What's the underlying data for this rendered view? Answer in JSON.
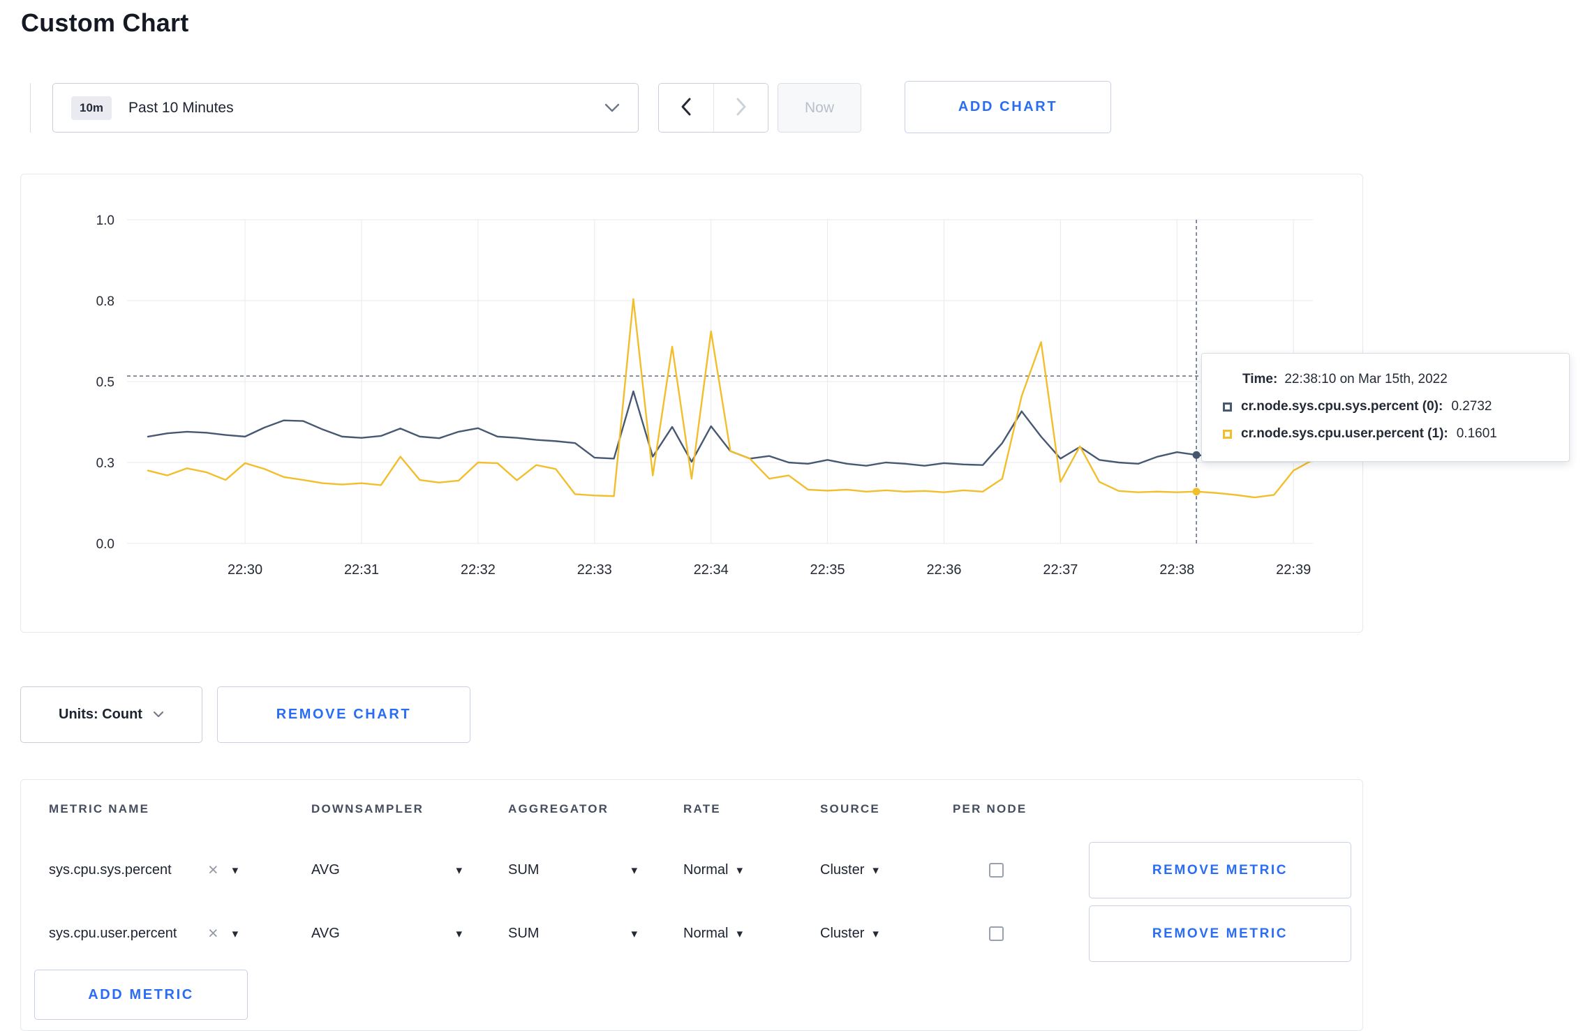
{
  "page": {
    "title": "Custom Chart"
  },
  "colors": {
    "accent_blue": "#2a6df4",
    "series_sys": "#475872",
    "series_user": "#f2be2c",
    "grid_line": "#e8eaee"
  },
  "icons": {
    "caret_down": "▾",
    "clear": "×"
  },
  "toolbar": {
    "time_badge": "10m",
    "time_range_label": "Past 10 Minutes",
    "now_label": "Now",
    "add_chart_label": "ADD CHART"
  },
  "chart_controls": {
    "units_label": "Units: Count",
    "remove_chart_label": "REMOVE CHART"
  },
  "tooltip": {
    "time_label": "Time:",
    "time_value": "22:38:10 on Mar 15th, 2022",
    "series": [
      {
        "name": "cr.node.sys.cpu.sys.percent (0):",
        "value": "0.2732"
      },
      {
        "name": "cr.node.sys.cpu.user.percent (1):",
        "value": "0.1601"
      }
    ]
  },
  "metrics_table": {
    "headers": [
      "METRIC NAME",
      "DOWNSAMPLER",
      "AGGREGATOR",
      "RATE",
      "SOURCE",
      "PER NODE"
    ],
    "rows": [
      {
        "metric": "sys.cpu.sys.percent",
        "downsampler": "AVG",
        "aggregator": "SUM",
        "rate": "Normal",
        "source": "Cluster",
        "per_node": false,
        "remove_label": "REMOVE METRIC"
      },
      {
        "metric": "sys.cpu.user.percent",
        "downsampler": "AVG",
        "aggregator": "SUM",
        "rate": "Normal",
        "source": "Cluster",
        "per_node": false,
        "remove_label": "REMOVE METRIC"
      }
    ],
    "add_metric_label": "ADD METRIC"
  },
  "chart_data": {
    "type": "line",
    "title": "",
    "x_start": "22:29:10",
    "x_end": "22:39:10",
    "x_interval_seconds": 10,
    "ylim": [
      0,
      1
    ],
    "grid": true,
    "yticks": [
      {
        "value": 0.0,
        "label": "0.0"
      },
      {
        "value": 0.25,
        "label": "0.3"
      },
      {
        "value": 0.5,
        "label": "0.5"
      },
      {
        "value": 0.75,
        "label": "0.8"
      },
      {
        "value": 1.0,
        "label": "1.0"
      }
    ],
    "xticks": [
      {
        "index": 5,
        "label": "22:30"
      },
      {
        "index": 11,
        "label": "22:31"
      },
      {
        "index": 17,
        "label": "22:32"
      },
      {
        "index": 23,
        "label": "22:33"
      },
      {
        "index": 29,
        "label": "22:34"
      },
      {
        "index": 35,
        "label": "22:35"
      },
      {
        "index": 41,
        "label": "22:36"
      },
      {
        "index": 47,
        "label": "22:37"
      },
      {
        "index": 53,
        "label": "22:38"
      },
      {
        "index": 59,
        "label": "22:39"
      }
    ],
    "crosshair": {
      "index": 54,
      "time": "22:38:10",
      "y_value": 0.517
    },
    "series": [
      {
        "name": "cr.node.sys.cpu.sys.percent",
        "color": "#475872",
        "highlight_value": 0.2732,
        "values": [
          0.33,
          0.34,
          0.345,
          0.342,
          0.335,
          0.33,
          0.358,
          0.38,
          0.378,
          0.352,
          0.33,
          0.326,
          0.332,
          0.355,
          0.33,
          0.325,
          0.345,
          0.356,
          0.33,
          0.326,
          0.32,
          0.316,
          0.31,
          0.265,
          0.262,
          0.47,
          0.268,
          0.36,
          0.252,
          0.362,
          0.285,
          0.262,
          0.27,
          0.25,
          0.246,
          0.258,
          0.246,
          0.24,
          0.25,
          0.246,
          0.24,
          0.248,
          0.244,
          0.242,
          0.31,
          0.408,
          0.33,
          0.262,
          0.298,
          0.258,
          0.25,
          0.246,
          0.268,
          0.282,
          0.2732,
          0.268,
          0.284,
          0.298,
          0.29,
          0.278,
          0.284
        ]
      },
      {
        "name": "cr.node.sys.cpu.user.percent",
        "color": "#f2be2c",
        "highlight_value": 0.1601,
        "values": [
          0.225,
          0.21,
          0.232,
          0.22,
          0.196,
          0.248,
          0.23,
          0.205,
          0.196,
          0.186,
          0.182,
          0.186,
          0.18,
          0.268,
          0.196,
          0.188,
          0.194,
          0.25,
          0.248,
          0.195,
          0.242,
          0.23,
          0.152,
          0.148,
          0.146,
          0.755,
          0.21,
          0.608,
          0.2,
          0.655,
          0.285,
          0.262,
          0.2,
          0.21,
          0.166,
          0.163,
          0.166,
          0.16,
          0.164,
          0.16,
          0.162,
          0.158,
          0.164,
          0.16,
          0.2,
          0.455,
          0.622,
          0.19,
          0.3,
          0.19,
          0.162,
          0.158,
          0.16,
          0.158,
          0.1601,
          0.156,
          0.15,
          0.142,
          0.15,
          0.225,
          0.258
        ]
      }
    ]
  }
}
